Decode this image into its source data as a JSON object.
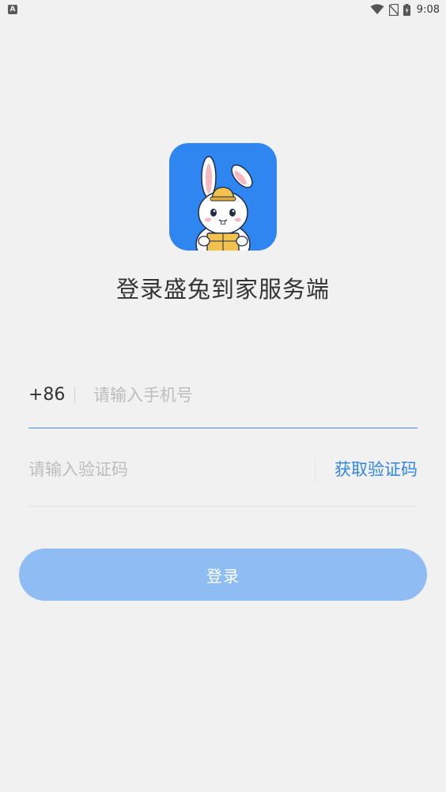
{
  "status_bar": {
    "left_icon": "A",
    "time": "9:08",
    "icons": [
      "wifi-icon",
      "no-sim-icon",
      "battery-icon"
    ]
  },
  "logo": {
    "icon": "rabbit-courier-logo",
    "background_color": "#2f86f0"
  },
  "title": "登录盛兔到家服务端",
  "phone": {
    "country_code": "+86",
    "value": "",
    "placeholder": "请输入手机号"
  },
  "verification": {
    "value": "",
    "placeholder": "请输入验证码",
    "get_code_label": "获取验证码"
  },
  "login_button": {
    "label": "登录"
  },
  "colors": {
    "accent": "#2f86e8",
    "button_disabled": "#8fbcf3",
    "background": "#f1f1f1"
  }
}
